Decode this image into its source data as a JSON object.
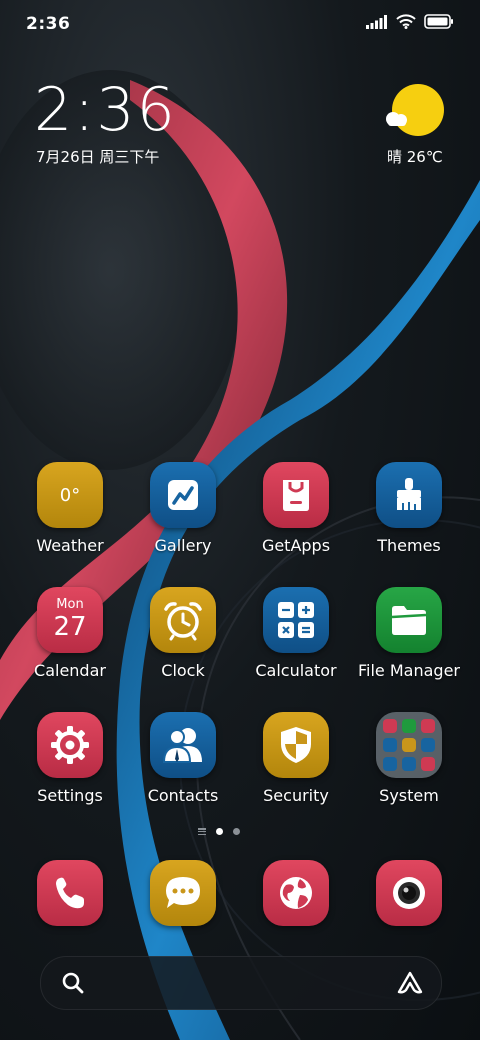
{
  "status_bar": {
    "time": "2:36",
    "icons": [
      "signal-icon",
      "wifi-icon",
      "battery-icon"
    ]
  },
  "clock_widget": {
    "time": "2:36",
    "date": "7月26日 周三下午"
  },
  "weather_widget": {
    "text": "晴 26℃",
    "icon": "sunny-icon"
  },
  "apps": [
    {
      "label": "Weather",
      "icon": "weather-icon",
      "color": "yellow",
      "text": "0°"
    },
    {
      "label": "Gallery",
      "icon": "gallery-icon",
      "color": "blue"
    },
    {
      "label": "GetApps",
      "icon": "shopping-bag-icon",
      "color": "red"
    },
    {
      "label": "Themes",
      "icon": "brush-icon",
      "color": "blue"
    },
    {
      "label": "Calendar",
      "icon": "calendar-icon",
      "color": "red",
      "day_name": "Mon",
      "day_num": "27"
    },
    {
      "label": "Clock",
      "icon": "alarm-clock-icon",
      "color": "yellow"
    },
    {
      "label": "Calculator",
      "icon": "calculator-icon",
      "color": "blue"
    },
    {
      "label": "File Manager",
      "icon": "folder-icon",
      "color": "green"
    },
    {
      "label": "Settings",
      "icon": "gear-icon",
      "color": "red"
    },
    {
      "label": "Contacts",
      "icon": "contacts-icon",
      "color": "blue"
    },
    {
      "label": "Security",
      "icon": "shield-icon",
      "color": "yellow"
    },
    {
      "label": "System",
      "icon": "system-folder-icon",
      "color": "folder"
    }
  ],
  "page_indicator": {
    "pages": 2,
    "active": 1
  },
  "dock": [
    {
      "name": "phone",
      "icon": "phone-icon",
      "color": "red"
    },
    {
      "name": "messages",
      "icon": "message-icon",
      "color": "yellow"
    },
    {
      "name": "browser",
      "icon": "globe-icon",
      "color": "red"
    },
    {
      "name": "camera",
      "icon": "camera-icon",
      "color": "red"
    }
  ],
  "search_bar": {
    "left_icon": "search-icon",
    "right_icon": "assistant-icon"
  },
  "colors": {
    "yellow": "#c9961a",
    "blue": "#1764a0",
    "red": "#cf3a53",
    "green": "#1f9a3d",
    "sun": "#f6cf10"
  }
}
